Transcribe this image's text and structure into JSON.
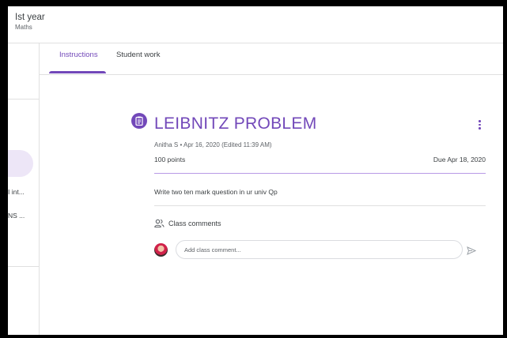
{
  "class": {
    "title": "Ist year",
    "subtitle": "Maths"
  },
  "tabs": [
    {
      "label": "Instructions",
      "active": true
    },
    {
      "label": "Student work",
      "active": false
    }
  ],
  "sidebar": {
    "items": [
      {
        "label": "I int..."
      },
      {
        "label": "NS ..."
      }
    ]
  },
  "assignment": {
    "title": "LEIBNITZ PROBLEM",
    "meta": "Anitha S • Apr 16, 2020 (Edited 11:39 AM)",
    "points": "100 points",
    "due": "Due Apr 18, 2020",
    "instructions": "Write two ten mark question in ur univ Qp",
    "icon": "assignment-icon"
  },
  "comments": {
    "label": "Class comments",
    "placeholder": "Add class comment..."
  },
  "colors": {
    "accent": "#7248b9",
    "accent_light": "#ede6f7",
    "divider": "#e0e0e0"
  }
}
